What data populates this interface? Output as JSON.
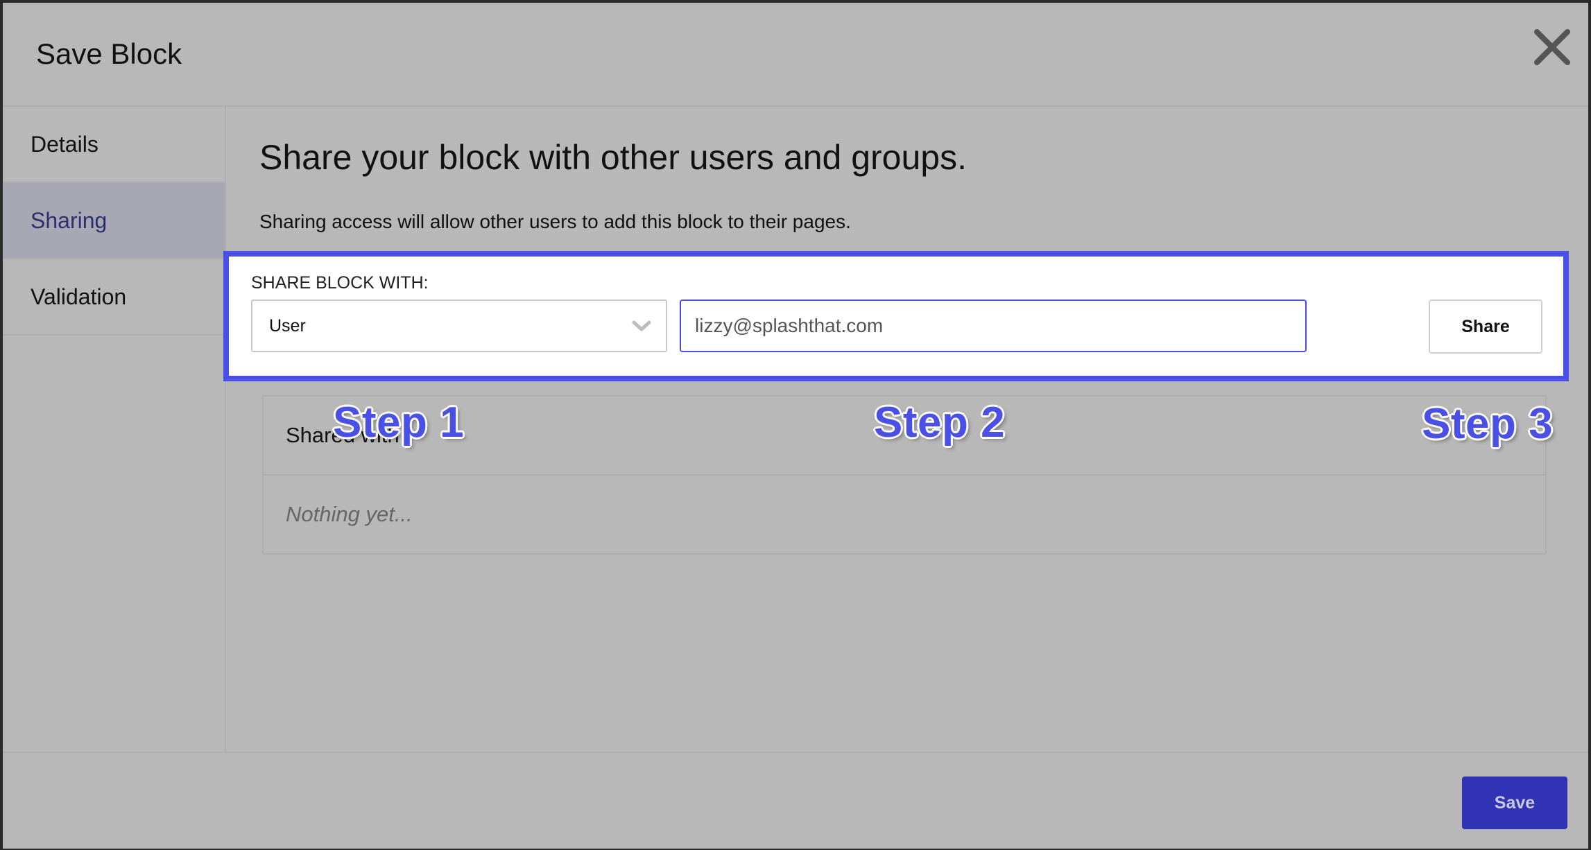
{
  "modal": {
    "title": "Save Block"
  },
  "sidebar": {
    "items": [
      {
        "label": "Details"
      },
      {
        "label": "Sharing"
      },
      {
        "label": "Validation"
      }
    ]
  },
  "main": {
    "title": "Share your block with other users and groups.",
    "description": "Sharing access will allow other users to add this block to their pages.",
    "share_form": {
      "label": "SHARE BLOCK WITH:",
      "type_selected": "User",
      "email_value": "lizzy@splashthat.com",
      "share_button": "Share"
    },
    "shared_with": {
      "header": "Shared with",
      "empty_text": "Nothing yet..."
    }
  },
  "annotations": {
    "step1": "Step 1",
    "step2": "Step 2",
    "step3": "Step 3"
  },
  "footer": {
    "save_label": "Save"
  },
  "colors": {
    "accent": "#4a50e6",
    "save_button": "#2f33b4",
    "overlay": "#b8b8b8"
  },
  "icons": {
    "close": "close-icon",
    "dropdown": "chevron-down-icon"
  }
}
